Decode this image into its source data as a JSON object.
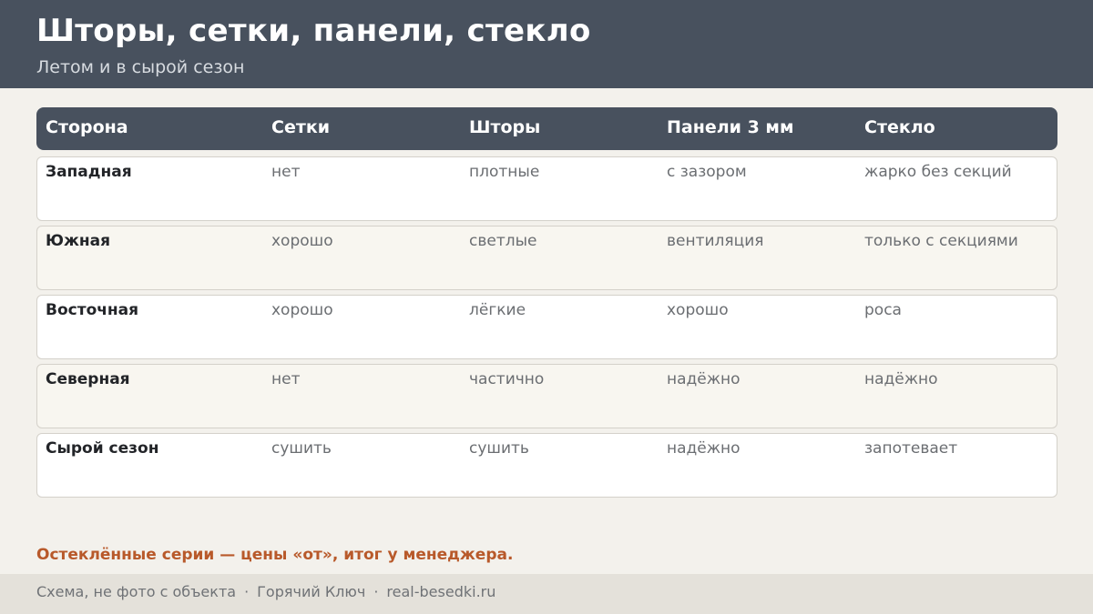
{
  "header": {
    "title": "Шторы, сетки, панели, стекло",
    "subtitle": "Летом и в сырой сезон"
  },
  "table": {
    "columns": [
      "Сторона",
      "Сетки",
      "Шторы",
      "Панели 3 мм",
      "Стекло"
    ],
    "rows": [
      [
        "Западная",
        "нет",
        "плотные",
        "с зазором",
        "жарко без секций"
      ],
      [
        "Южная",
        "хорошо",
        "светлые",
        "вентиляция",
        "только с секциями"
      ],
      [
        "Восточная",
        "хорошо",
        "лёгкие",
        "хорошо",
        "роса"
      ],
      [
        "Северная",
        "нет",
        "частично",
        "надёжно",
        "надёжно"
      ],
      [
        "Сырой сезон",
        "сушить",
        "сушить",
        "надёжно",
        "запотевает"
      ]
    ]
  },
  "note": "Остеклённые серии — цены «от», итог у менеджера.",
  "footer": {
    "items": [
      "Схема, не фото с объекта",
      "Горячий Ключ",
      "real-besedki.ru"
    ],
    "separator": "·"
  },
  "colors": {
    "header_bg": "#48515e",
    "accent": "#b8592a",
    "page_bg": "#f3f1ec"
  }
}
